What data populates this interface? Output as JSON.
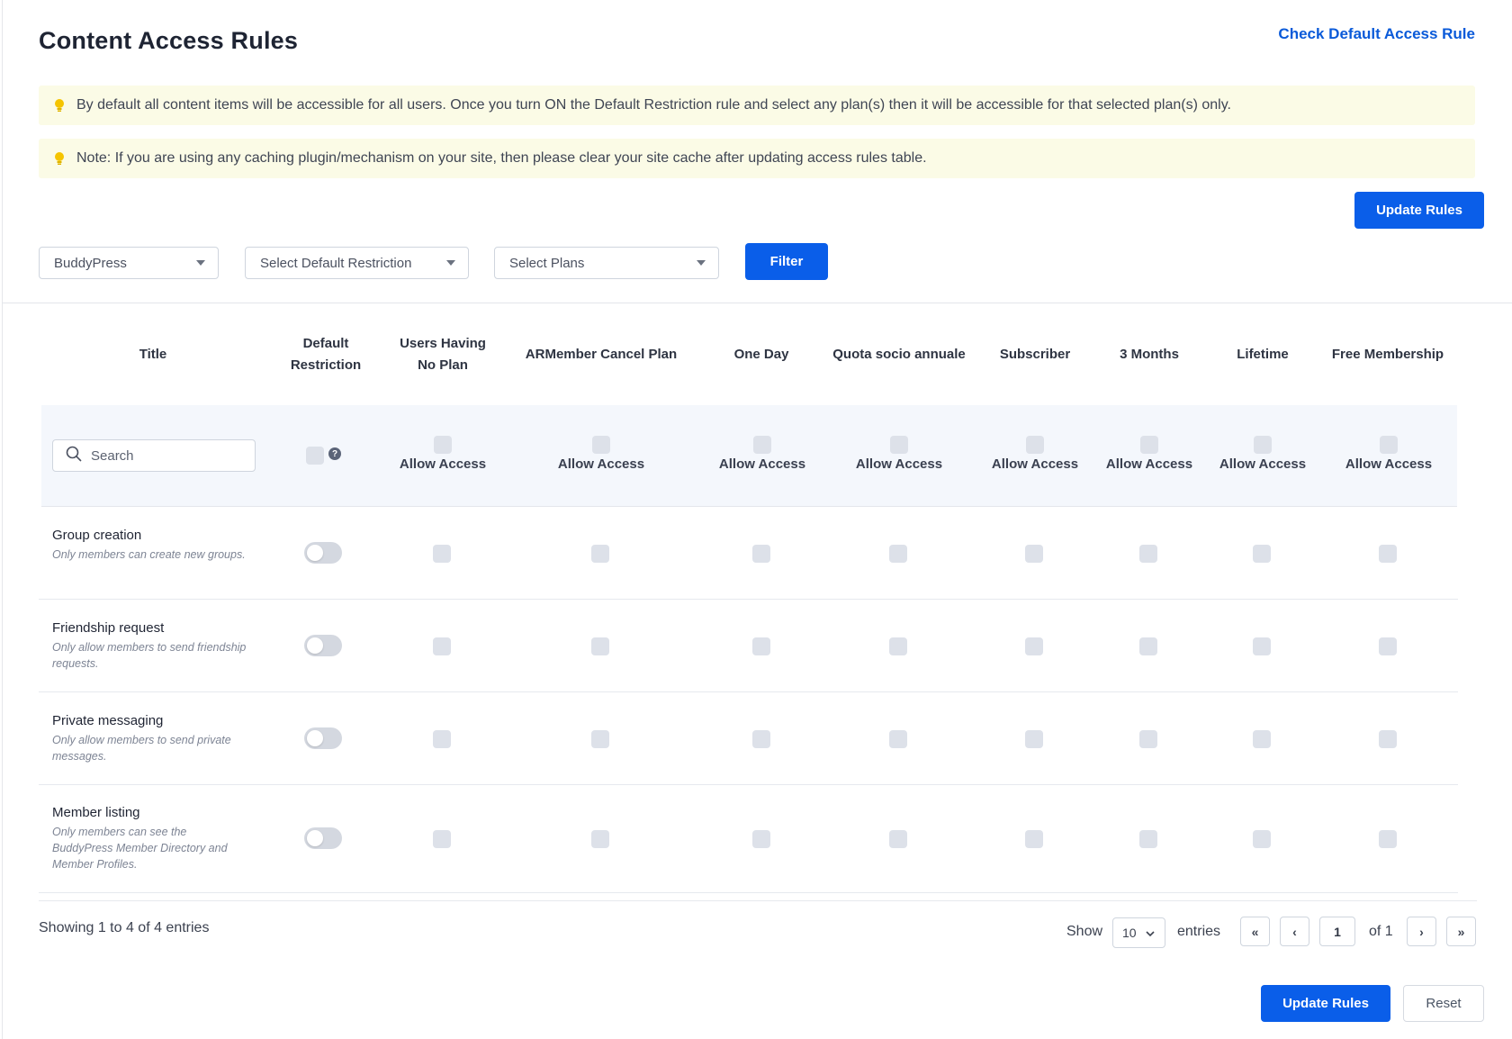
{
  "header": {
    "title": "Content Access Rules",
    "check_link": "Check Default Access Rule"
  },
  "notices": [
    "By default all content items will be accessible for all users. Once you turn ON the Default Restriction rule and select any plan(s) then it will be accessible for that selected plan(s) only.",
    "Note: If you are using any caching plugin/mechanism on your site, then please clear your site cache after updating access rules table."
  ],
  "toolbar": {
    "update_label": "Update Rules",
    "filter_label": "Filter",
    "selects": {
      "content_type": "BuddyPress",
      "default_restriction": "Select Default Restriction",
      "plans": "Select Plans"
    }
  },
  "table": {
    "headers": {
      "title": "Title",
      "default_restriction_l1": "Default",
      "default_restriction_l2": "Restriction",
      "no_plan_l1": "Users Having",
      "no_plan_l2": "No Plan",
      "plans": [
        "ARMember Cancel Plan",
        "One Day",
        "Quota socio annuale",
        "Subscriber",
        "3 Months",
        "Lifetime",
        "Free Membership"
      ]
    },
    "search_placeholder": "Search",
    "allow_label": "Allow Access",
    "help_glyph": "?",
    "rows": [
      {
        "title": "Group creation",
        "desc": "Only members can create new groups.",
        "default_on": false
      },
      {
        "title": "Friendship request",
        "desc": "Only allow members to send friendship requests.",
        "default_on": false
      },
      {
        "title": "Private messaging",
        "desc": "Only allow members to send private messages.",
        "default_on": false
      },
      {
        "title": "Member listing",
        "desc": "Only members can see the BuddyPress Member Directory and Member Profiles.",
        "default_on": false
      }
    ]
  },
  "footer": {
    "showing": "Showing 1 to 4 of 4 entries",
    "show_label": "Show",
    "page_size": "10",
    "entries_label": "entries",
    "first": "«",
    "prev": "‹",
    "page": "1",
    "of_label": "of 1",
    "next": "›",
    "last": "»",
    "update_label": "Update Rules",
    "reset_label": "Reset"
  },
  "colors": {
    "primary": "#0a5ee9",
    "notice_bg": "#fbfbe6",
    "bulb": "#f5c400"
  }
}
